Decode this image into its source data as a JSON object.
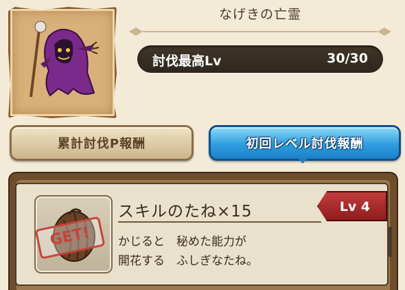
{
  "monster": {
    "name": "なげきの亡霊",
    "max_level_label": "討伐最高Lv",
    "max_level_value": "30/30"
  },
  "tabs": [
    {
      "label": "累計討伐P報酬",
      "selected": false
    },
    {
      "label": "初回レベル討伐報酬",
      "selected": true
    }
  ],
  "reward": {
    "name": "スキルのたね×15",
    "level": "Lv 4",
    "stamp": "GET!",
    "description": [
      "かじると　秘めた能力が",
      "開花する　ふしぎなたね。"
    ]
  },
  "colors": {
    "selected_tab": "#2e9ee0",
    "level_badge": "#c23b3b",
    "stamp": "#c7443b"
  }
}
